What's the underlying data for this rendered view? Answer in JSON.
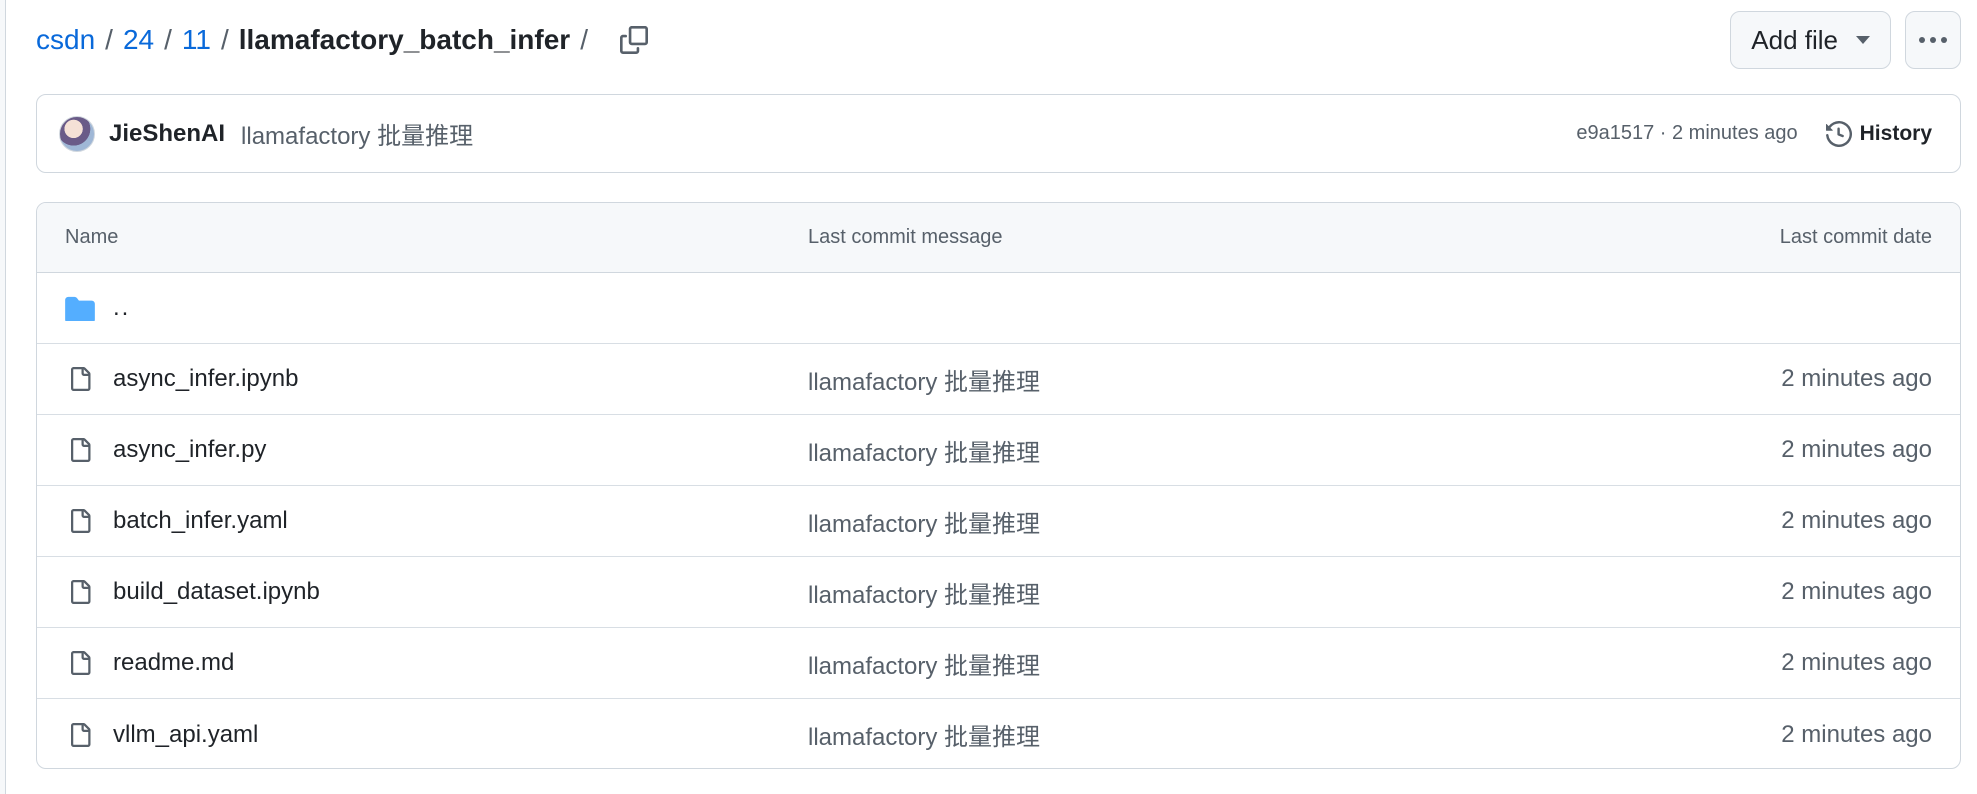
{
  "breadcrumb": {
    "items": [
      "csdn",
      "24",
      "11"
    ],
    "separator": "/",
    "current": "llamafactory_batch_infer",
    "trailing_separator": "/"
  },
  "header": {
    "add_file_label": "Add file"
  },
  "commit": {
    "author": "JieShenAI",
    "message": "llamafactory 批量推理",
    "meta": "e9a1517 · 2 minutes ago",
    "history_label": "History"
  },
  "table": {
    "columns": {
      "name": "Name",
      "message": "Last commit message",
      "date": "Last commit date"
    },
    "parent_label": "..",
    "files": [
      {
        "name": "async_infer.ipynb",
        "message": "llamafactory 批量推理",
        "date": "2 minutes ago"
      },
      {
        "name": "async_infer.py",
        "message": "llamafactory 批量推理",
        "date": "2 minutes ago"
      },
      {
        "name": "batch_infer.yaml",
        "message": "llamafactory 批量推理",
        "date": "2 minutes ago"
      },
      {
        "name": "build_dataset.ipynb",
        "message": "llamafactory 批量推理",
        "date": "2 minutes ago"
      },
      {
        "name": "readme.md",
        "message": "llamafactory 批量推理",
        "date": "2 minutes ago"
      },
      {
        "name": "vllm_api.yaml",
        "message": "llamafactory 批量推理",
        "date": "2 minutes ago"
      }
    ]
  },
  "colors": {
    "link": "#0969da",
    "folder": "#54aeff",
    "muted": "#57606a",
    "border": "#d0d7de"
  },
  "icons": [
    "copy-icon",
    "caret-down-icon",
    "kebab-horizontal-icon",
    "history-icon",
    "folder-icon",
    "file-icon"
  ]
}
